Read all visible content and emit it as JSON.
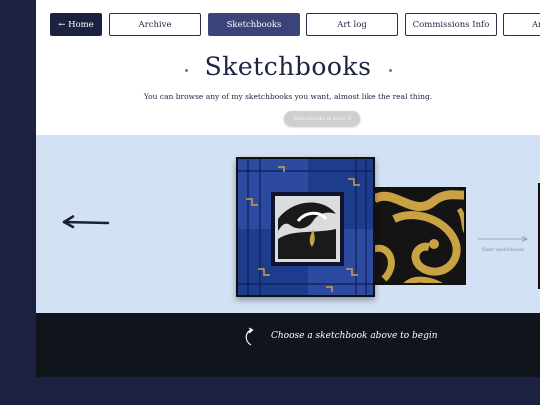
{
  "nav": {
    "home_label": "← Home",
    "items": [
      "Archive",
      "Sketchbooks",
      "Art log",
      "Commissions Info",
      "Ar"
    ],
    "active": "Sketchbooks"
  },
  "page": {
    "title": "Sketchbooks",
    "subtitle": "You can browse any of my sketchbooks you want, almost like the real thing.",
    "pill_label": "Sketchbooks in total: 9"
  },
  "carousel": {
    "older_label": "Older sketchbooks"
  },
  "footer": {
    "prompt": "Choose a sketchbook above to begin"
  },
  "colors": {
    "background": "#1c2140",
    "carousel_bg": "#d3e1f4",
    "footer_bg": "#0f151b",
    "active_nav": "#3a4478",
    "book_blue": "#1d3c8c",
    "book_gold": "#c9a243"
  }
}
